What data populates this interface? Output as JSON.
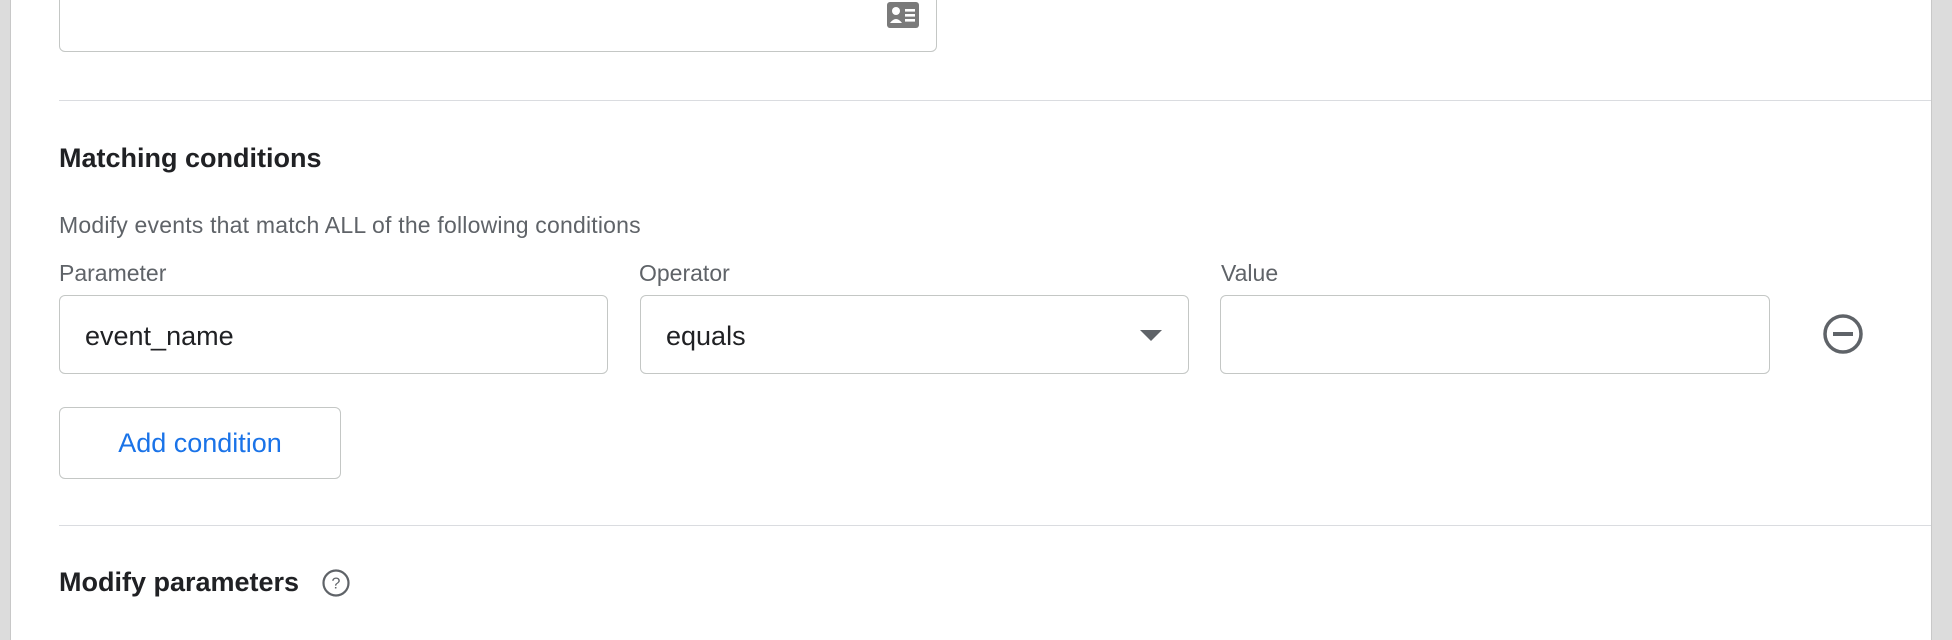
{
  "matching": {
    "title": "Matching conditions",
    "description": "Modify events that match ALL of the following conditions",
    "parameter": {
      "label": "Parameter",
      "value": "event_name"
    },
    "operator": {
      "label": "Operator",
      "value": "equals"
    },
    "value": {
      "label": "Value",
      "value": ""
    },
    "add_condition_label": "Add condition"
  },
  "modify_parameters": {
    "title": "Modify parameters",
    "help_icon": "help-circle-icon"
  },
  "icons": {
    "contact": "contact-card-icon",
    "remove": "remove-circle-icon",
    "dropdown": "dropdown-arrow-icon"
  },
  "colors": {
    "accent": "#1a73e8",
    "border": "#c4c7c5",
    "divider": "#dadce0",
    "muted_text": "#5f6368"
  }
}
